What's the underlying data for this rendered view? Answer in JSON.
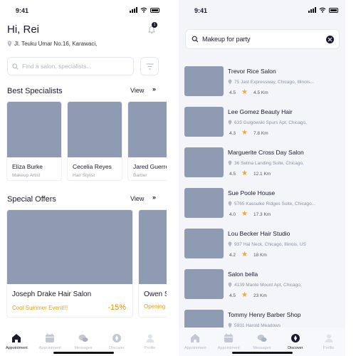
{
  "home": {
    "status_time": "9:41",
    "greeting": "Hi, Rei",
    "notification_count": "1",
    "address": "Jl. Teuku Umar No.16, Karawaci,",
    "search_placeholder": "Find a salon, specialists...",
    "specialists": {
      "title": "Best Specialists",
      "view_label": "View",
      "view_arrow": "»",
      "items": [
        {
          "name": "Eliza Burke",
          "role": "Makeup Artist"
        },
        {
          "name": "Cecelia Reyes",
          "role": "Hair Stylist"
        },
        {
          "name": "Jared Guerrero",
          "role": "Barber"
        }
      ]
    },
    "offers": {
      "title": "Special Offers",
      "view_label": "View",
      "view_arrow": "»",
      "items": [
        {
          "name": "Joseph Drake Hair Salon",
          "event": "Cool Summer Event!!!",
          "discount": "-15%"
        },
        {
          "name": "Owen Salon",
          "event": "Opening Sale",
          "discount": ""
        }
      ]
    }
  },
  "discover": {
    "status_time": "9:41",
    "search_value": "Makeup for party",
    "results": [
      {
        "name": "Trevor Rice Salon",
        "address": "75 Jast Expressway, Chicago, Illinois...",
        "rating": "4.5",
        "distance": "4.5 Km"
      },
      {
        "name": "Lee Gomez Beauty Hair",
        "address": "633 Gulgowski Spurs Apt, Chicago,",
        "rating": "4.3",
        "distance": "7.8 Km"
      },
      {
        "name": "Marguerite Cross Day Salon",
        "address": "36 Selina Landing Suite, Chicago,",
        "rating": "4.5",
        "distance": "12.1 Km"
      },
      {
        "name": "Sue Poole House",
        "address": "5765 Kassulke Ridges Suite, Chicago...",
        "rating": "4.0",
        "distance": "17.3 Km"
      },
      {
        "name": "Lou Becker Hair Studio",
        "address": "937 Hal Neck, Chicago, Illinois, US",
        "rating": "4.2",
        "distance": "18 Km"
      },
      {
        "name": "Salon bella",
        "address": "4139 Mante Mount Apt, Chicago,",
        "rating": "4.5",
        "distance": "23 Km"
      },
      {
        "name": "Tommy Henry Barber Shop",
        "address": "5931 Harold Meadows",
        "rating": "",
        "distance": ""
      }
    ]
  },
  "tabs": {
    "appointment_home": "Appointment",
    "appointment": "Appointment",
    "messages": "Messages",
    "discover": "Discover",
    "profile": "Profile"
  },
  "colors": {
    "primary": "#1a1a2e",
    "placeholder_image": "#8e9bb2",
    "accent_orange": "#e0901a",
    "star": "#f3a72f"
  }
}
